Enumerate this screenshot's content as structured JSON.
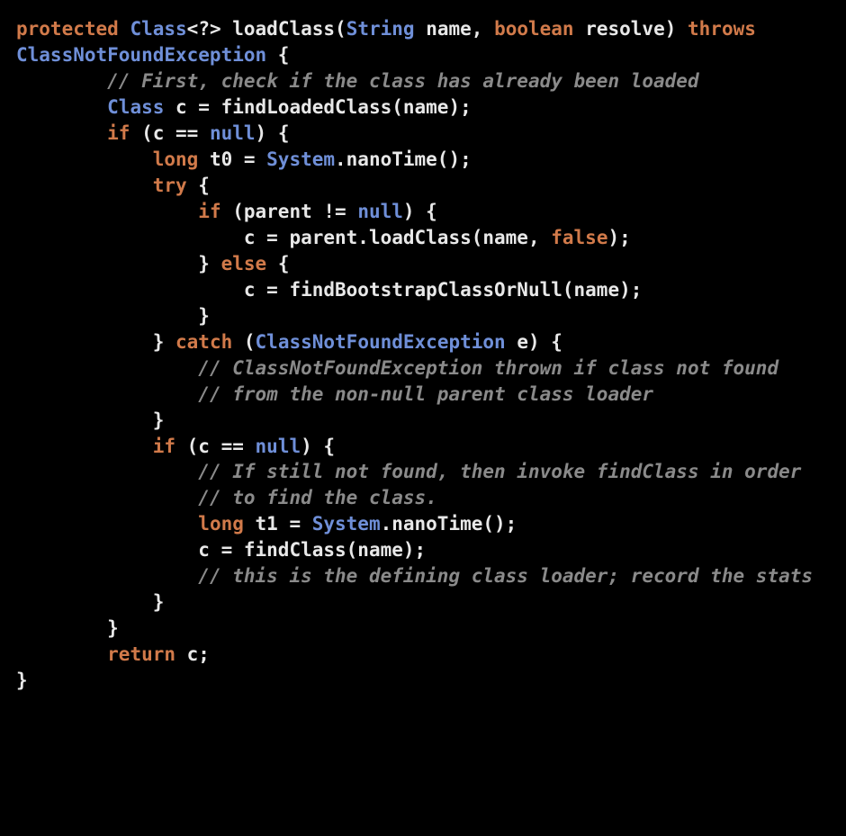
{
  "code": {
    "tokens": [
      {
        "t": "protected",
        "c": "kw"
      },
      {
        "t": " ",
        "c": "pln"
      },
      {
        "t": "Class",
        "c": "typ"
      },
      {
        "t": "<?> ",
        "c": "pln"
      },
      {
        "t": "loadClass(",
        "c": "pln"
      },
      {
        "t": "String",
        "c": "typ"
      },
      {
        "t": " name, ",
        "c": "pln"
      },
      {
        "t": "boolean",
        "c": "kw"
      },
      {
        "t": " resolve) ",
        "c": "pln"
      },
      {
        "t": "throws",
        "c": "kw"
      },
      {
        "t": " ",
        "c": "pln"
      },
      {
        "t": "ClassNotFoundException",
        "c": "typ"
      },
      {
        "t": " {\n",
        "c": "pln"
      },
      {
        "t": "        ",
        "c": "pln"
      },
      {
        "t": "// First, check if the class has already been loaded",
        "c": "cmt"
      },
      {
        "t": "\n",
        "c": "pln"
      },
      {
        "t": "        ",
        "c": "pln"
      },
      {
        "t": "Class",
        "c": "typ"
      },
      {
        "t": " c = findLoadedClass(name);\n",
        "c": "pln"
      },
      {
        "t": "        ",
        "c": "pln"
      },
      {
        "t": "if",
        "c": "kw"
      },
      {
        "t": " (c == ",
        "c": "pln"
      },
      {
        "t": "null",
        "c": "nul"
      },
      {
        "t": ") {\n",
        "c": "pln"
      },
      {
        "t": "            ",
        "c": "pln"
      },
      {
        "t": "long",
        "c": "kw"
      },
      {
        "t": " t0 = ",
        "c": "pln"
      },
      {
        "t": "System",
        "c": "typ"
      },
      {
        "t": ".nanoTime();\n",
        "c": "pln"
      },
      {
        "t": "            ",
        "c": "pln"
      },
      {
        "t": "try",
        "c": "kw"
      },
      {
        "t": " {\n",
        "c": "pln"
      },
      {
        "t": "                ",
        "c": "pln"
      },
      {
        "t": "if",
        "c": "kw"
      },
      {
        "t": " (parent != ",
        "c": "pln"
      },
      {
        "t": "null",
        "c": "nul"
      },
      {
        "t": ") {\n",
        "c": "pln"
      },
      {
        "t": "                    c = parent.loadClass(name, ",
        "c": "pln"
      },
      {
        "t": "false",
        "c": "kw"
      },
      {
        "t": ");\n",
        "c": "pln"
      },
      {
        "t": "                } ",
        "c": "pln"
      },
      {
        "t": "else",
        "c": "kw"
      },
      {
        "t": " {\n",
        "c": "pln"
      },
      {
        "t": "                    c = findBootstrapClassOrNull(name);\n",
        "c": "pln"
      },
      {
        "t": "                }\n",
        "c": "pln"
      },
      {
        "t": "            } ",
        "c": "pln"
      },
      {
        "t": "catch",
        "c": "kw"
      },
      {
        "t": " (",
        "c": "pln"
      },
      {
        "t": "ClassNotFoundException",
        "c": "typ"
      },
      {
        "t": " e) {\n",
        "c": "pln"
      },
      {
        "t": "                ",
        "c": "pln"
      },
      {
        "t": "// ClassNotFoundException thrown if class not found",
        "c": "cmt"
      },
      {
        "t": "\n",
        "c": "pln"
      },
      {
        "t": "                ",
        "c": "pln"
      },
      {
        "t": "// from the non-null parent class loader",
        "c": "cmt"
      },
      {
        "t": "\n",
        "c": "pln"
      },
      {
        "t": "            }\n",
        "c": "pln"
      },
      {
        "t": "            ",
        "c": "pln"
      },
      {
        "t": "if",
        "c": "kw"
      },
      {
        "t": " (c == ",
        "c": "pln"
      },
      {
        "t": "null",
        "c": "nul"
      },
      {
        "t": ") {\n",
        "c": "pln"
      },
      {
        "t": "                ",
        "c": "pln"
      },
      {
        "t": "// If still not found, then invoke findClass in order",
        "c": "cmt"
      },
      {
        "t": "\n",
        "c": "pln"
      },
      {
        "t": "                ",
        "c": "pln"
      },
      {
        "t": "// to find the class.",
        "c": "cmt"
      },
      {
        "t": "\n",
        "c": "pln"
      },
      {
        "t": "                ",
        "c": "pln"
      },
      {
        "t": "long",
        "c": "kw"
      },
      {
        "t": " t1 = ",
        "c": "pln"
      },
      {
        "t": "System",
        "c": "typ"
      },
      {
        "t": ".nanoTime();\n",
        "c": "pln"
      },
      {
        "t": "                c = findClass(name);\n",
        "c": "pln"
      },
      {
        "t": "                ",
        "c": "pln"
      },
      {
        "t": "// this is the defining class loader; record the stats",
        "c": "cmt"
      },
      {
        "t": "\n",
        "c": "pln"
      },
      {
        "t": "            }\n",
        "c": "pln"
      },
      {
        "t": "        }\n",
        "c": "pln"
      },
      {
        "t": "        ",
        "c": "pln"
      },
      {
        "t": "return",
        "c": "kw"
      },
      {
        "t": " c;\n",
        "c": "pln"
      },
      {
        "t": "}",
        "c": "pln"
      }
    ]
  }
}
